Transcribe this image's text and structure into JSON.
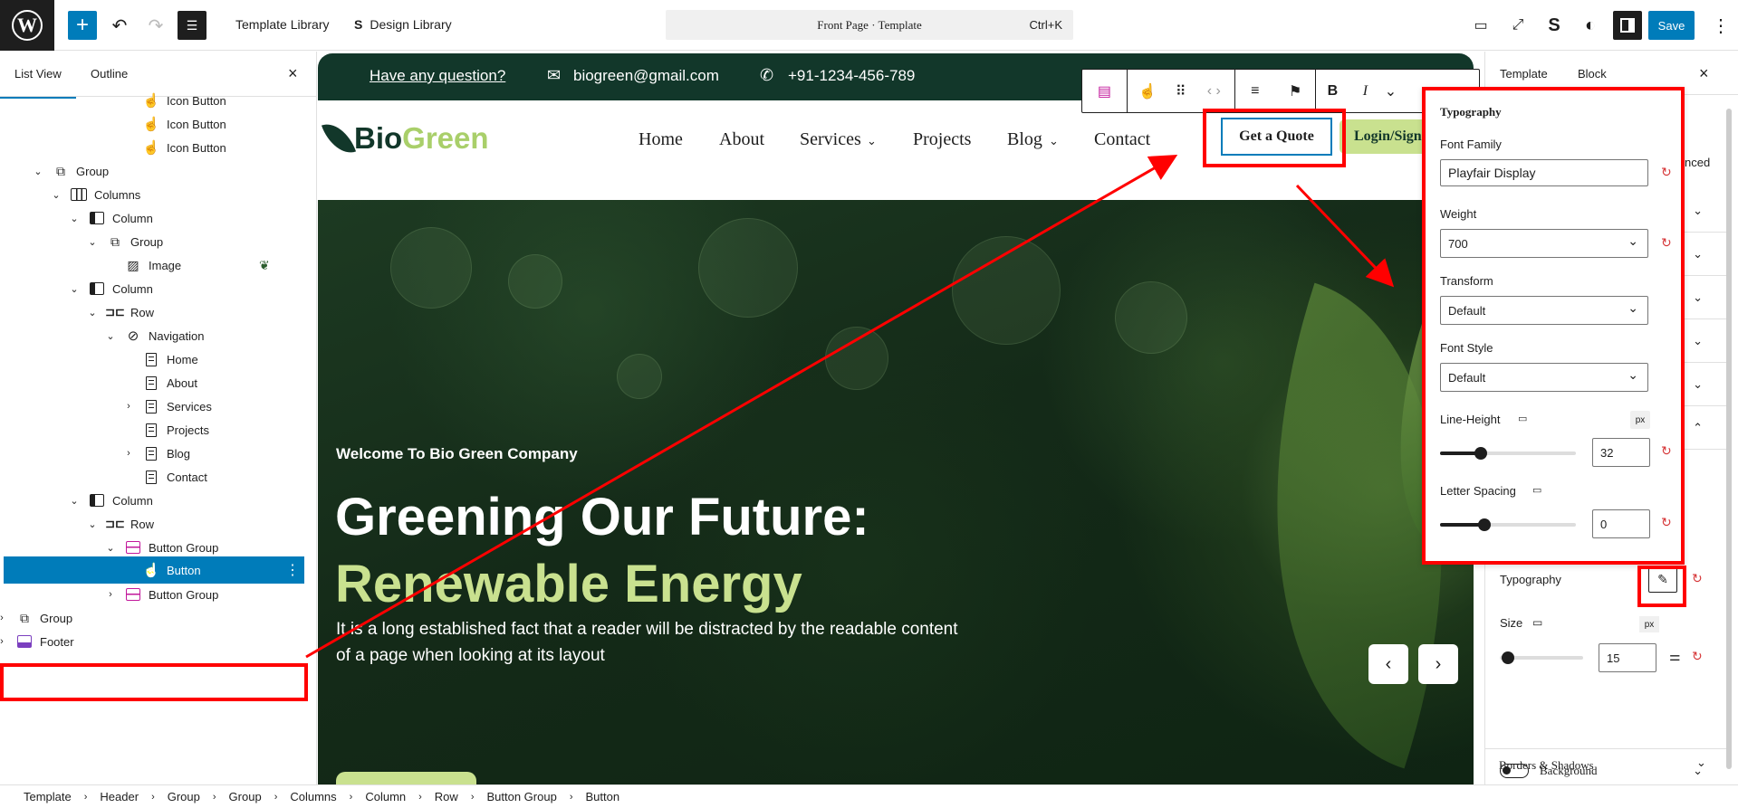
{
  "topbar": {
    "template_library": "Template Library",
    "design_library": "Design Library",
    "document_title": "Front Page · Template",
    "shortcut": "Ctrl+K",
    "save": "Save"
  },
  "left_panel": {
    "tabs": [
      "List View",
      "Outline"
    ],
    "tree": [
      {
        "label": "Icon Button",
        "icon": "icon-button-icon"
      },
      {
        "label": "Icon Button",
        "icon": "icon-button-icon"
      },
      {
        "label": "Icon Button",
        "icon": "icon-button-icon"
      },
      {
        "label": "Group",
        "icon": "group-icon"
      },
      {
        "label": "Columns",
        "icon": "columns-icon"
      },
      {
        "label": "Column",
        "icon": "column-icon"
      },
      {
        "label": "Group",
        "icon": "group-icon"
      },
      {
        "label": "Image",
        "icon": "image-icon"
      },
      {
        "label": "Column",
        "icon": "column-icon"
      },
      {
        "label": "Row",
        "icon": "row-icon"
      },
      {
        "label": "Navigation",
        "icon": "navigation-icon"
      },
      {
        "label": "Home",
        "icon": "page-icon"
      },
      {
        "label": "About",
        "icon": "page-icon"
      },
      {
        "label": "Services",
        "icon": "page-icon"
      },
      {
        "label": "Projects",
        "icon": "page-icon"
      },
      {
        "label": "Blog",
        "icon": "page-icon"
      },
      {
        "label": "Contact",
        "icon": "page-icon"
      },
      {
        "label": "Column",
        "icon": "column-icon"
      },
      {
        "label": "Row",
        "icon": "row-icon"
      },
      {
        "label": "Button Group",
        "icon": "button-group-icon"
      },
      {
        "label": "Button",
        "icon": "icon-button-icon"
      },
      {
        "label": "Button Group",
        "icon": "button-group-icon"
      },
      {
        "label": "Group",
        "icon": "group-icon"
      },
      {
        "label": "Footer",
        "icon": "footer-icon"
      }
    ]
  },
  "breadcrumb": [
    "Template",
    "Header",
    "Group",
    "Group",
    "Columns",
    "Column",
    "Row",
    "Button Group",
    "Button"
  ],
  "site": {
    "question": "Have any question?",
    "email": "biogreen@gmail.com",
    "phone": "+91-1234-456-789",
    "logo_bio": "Bio",
    "logo_green": "Green",
    "nav": [
      "Home",
      "About",
      "Services",
      "Projects",
      "Blog",
      "Contact"
    ],
    "quote_btn": "Get a Quote",
    "login_btn": "Login/Sign",
    "hero_small": "Welcome To Bio Green Company",
    "hero_line1": "Greening Our Future:",
    "hero_line2": "Renewable Energy",
    "hero_text": "It is a long established fact that a reader will be distracted by the readable content of a page when looking at its layout"
  },
  "right_panel": {
    "tabs": [
      "Template",
      "Block"
    ],
    "advanced_partial": "nced",
    "typography_label": "Typography",
    "size_label": "Size",
    "size_unit": "px",
    "size_value": "15",
    "background_label": "Background",
    "borders_label": "Borders & Shadows"
  },
  "typography_popover": {
    "title": "Typography",
    "font_family_label": "Font Family",
    "font_family_value": "Playfair Display",
    "weight_label": "Weight",
    "weight_value": "700",
    "transform_label": "Transform",
    "transform_value": "Default",
    "font_style_label": "Font Style",
    "font_style_value": "Default",
    "line_height_label": "Line-Height",
    "line_height_unit": "px",
    "line_height_value": "32",
    "letter_spacing_label": "Letter Spacing",
    "letter_spacing_value": "0"
  },
  "colors": {
    "accent": "#007cba",
    "site_dark": "#12372a",
    "site_lime": "#c9e18f",
    "annotation": "#ff0000"
  }
}
